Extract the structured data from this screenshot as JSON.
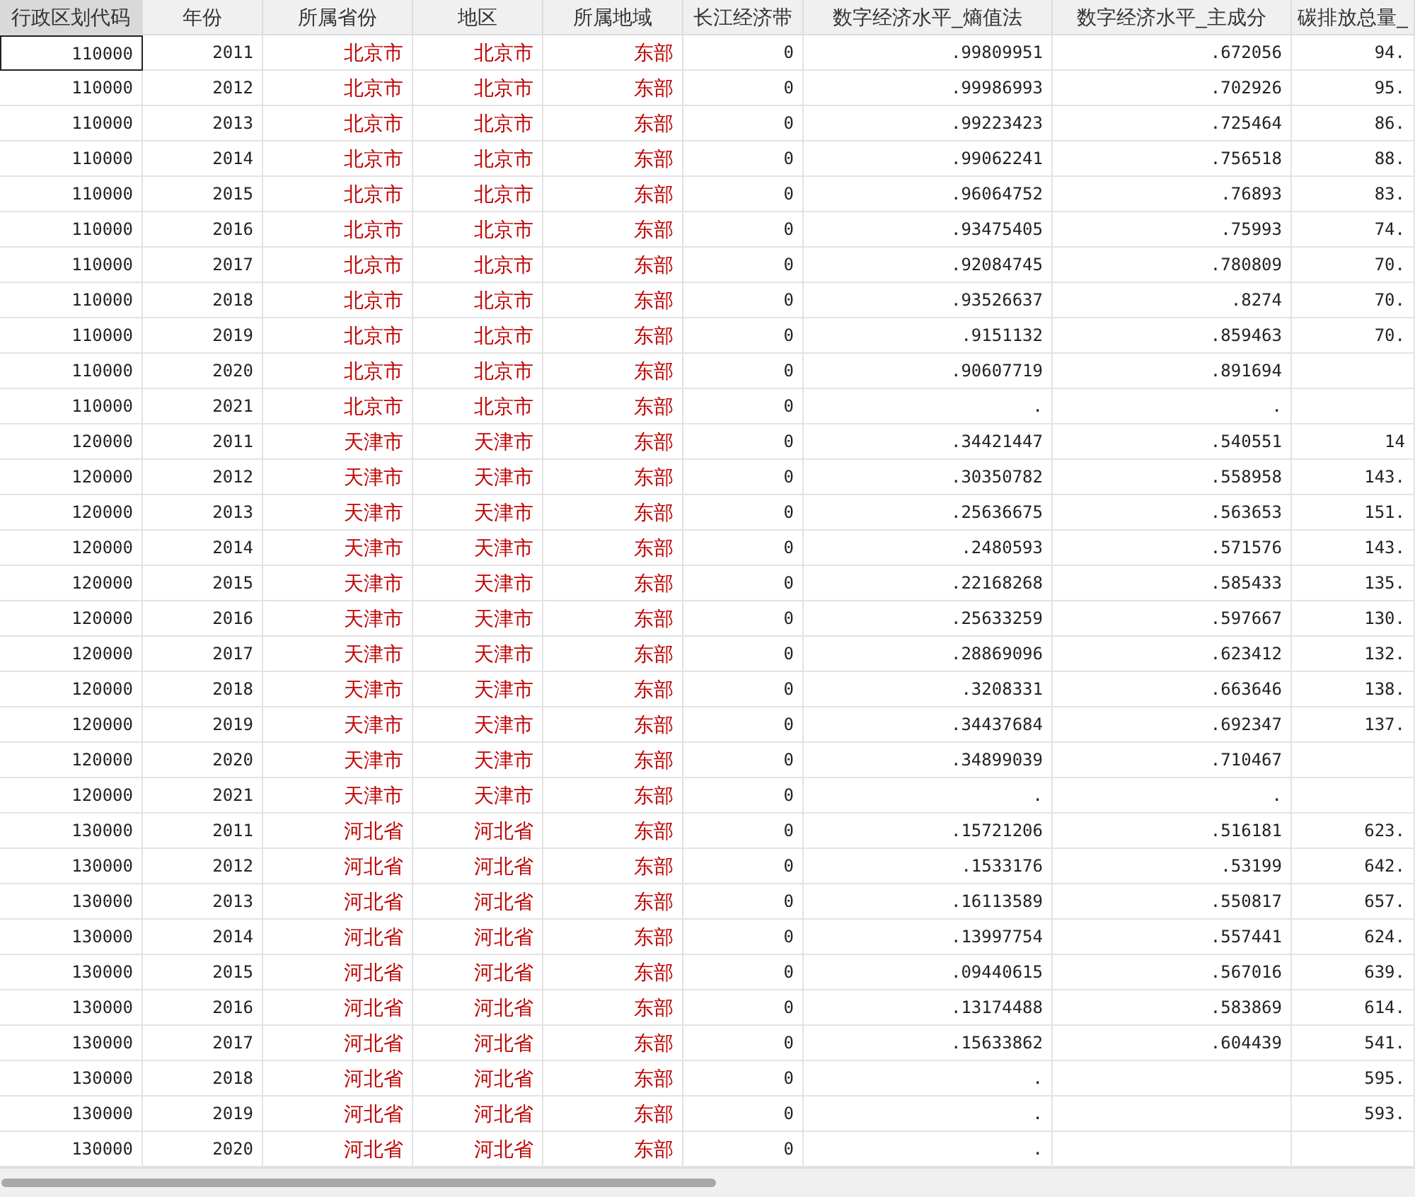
{
  "table": {
    "columns": [
      {
        "label": "行政区划代码",
        "kind": "numeric",
        "selected": true
      },
      {
        "label": "年份",
        "kind": "numeric",
        "selected": false
      },
      {
        "label": "所属省份",
        "kind": "string",
        "selected": false
      },
      {
        "label": "地区",
        "kind": "string",
        "selected": false
      },
      {
        "label": "所属地域",
        "kind": "string",
        "selected": false
      },
      {
        "label": "长江经济带",
        "kind": "numeric",
        "selected": false
      },
      {
        "label": "数字经济水平_熵值法",
        "kind": "numeric",
        "selected": false
      },
      {
        "label": "数字经济水平_主成分",
        "kind": "numeric",
        "selected": false
      },
      {
        "label": "碳排放总量_",
        "kind": "numeric",
        "selected": false
      }
    ],
    "rows": [
      {
        "focused": true,
        "cells": [
          "110000",
          "2011",
          "北京市",
          "北京市",
          "东部",
          "0",
          ".99809951",
          ".672056",
          "94."
        ]
      },
      {
        "focused": false,
        "cells": [
          "110000",
          "2012",
          "北京市",
          "北京市",
          "东部",
          "0",
          ".99986993",
          ".702926",
          "95."
        ]
      },
      {
        "focused": false,
        "cells": [
          "110000",
          "2013",
          "北京市",
          "北京市",
          "东部",
          "0",
          ".99223423",
          ".725464",
          "86."
        ]
      },
      {
        "focused": false,
        "cells": [
          "110000",
          "2014",
          "北京市",
          "北京市",
          "东部",
          "0",
          ".99062241",
          ".756518",
          "88."
        ]
      },
      {
        "focused": false,
        "cells": [
          "110000",
          "2015",
          "北京市",
          "北京市",
          "东部",
          "0",
          ".96064752",
          ".76893",
          "83."
        ]
      },
      {
        "focused": false,
        "cells": [
          "110000",
          "2016",
          "北京市",
          "北京市",
          "东部",
          "0",
          ".93475405",
          ".75993",
          "74."
        ]
      },
      {
        "focused": false,
        "cells": [
          "110000",
          "2017",
          "北京市",
          "北京市",
          "东部",
          "0",
          ".92084745",
          ".780809",
          "70."
        ]
      },
      {
        "focused": false,
        "cells": [
          "110000",
          "2018",
          "北京市",
          "北京市",
          "东部",
          "0",
          ".93526637",
          ".8274",
          "70."
        ]
      },
      {
        "focused": false,
        "cells": [
          "110000",
          "2019",
          "北京市",
          "北京市",
          "东部",
          "0",
          ".9151132",
          ".859463",
          "70."
        ]
      },
      {
        "focused": false,
        "cells": [
          "110000",
          "2020",
          "北京市",
          "北京市",
          "东部",
          "0",
          ".90607719",
          ".891694",
          ""
        ]
      },
      {
        "focused": false,
        "cells": [
          "110000",
          "2021",
          "北京市",
          "北京市",
          "东部",
          "0",
          ".",
          ".",
          ""
        ]
      },
      {
        "focused": false,
        "cells": [
          "120000",
          "2011",
          "天津市",
          "天津市",
          "东部",
          "0",
          ".34421447",
          ".540551",
          "14"
        ]
      },
      {
        "focused": false,
        "cells": [
          "120000",
          "2012",
          "天津市",
          "天津市",
          "东部",
          "0",
          ".30350782",
          ".558958",
          "143."
        ]
      },
      {
        "focused": false,
        "cells": [
          "120000",
          "2013",
          "天津市",
          "天津市",
          "东部",
          "0",
          ".25636675",
          ".563653",
          "151."
        ]
      },
      {
        "focused": false,
        "cells": [
          "120000",
          "2014",
          "天津市",
          "天津市",
          "东部",
          "0",
          ".2480593",
          ".571576",
          "143."
        ]
      },
      {
        "focused": false,
        "cells": [
          "120000",
          "2015",
          "天津市",
          "天津市",
          "东部",
          "0",
          ".22168268",
          ".585433",
          "135."
        ]
      },
      {
        "focused": false,
        "cells": [
          "120000",
          "2016",
          "天津市",
          "天津市",
          "东部",
          "0",
          ".25633259",
          ".597667",
          "130."
        ]
      },
      {
        "focused": false,
        "cells": [
          "120000",
          "2017",
          "天津市",
          "天津市",
          "东部",
          "0",
          ".28869096",
          ".623412",
          "132."
        ]
      },
      {
        "focused": false,
        "cells": [
          "120000",
          "2018",
          "天津市",
          "天津市",
          "东部",
          "0",
          ".3208331",
          ".663646",
          "138."
        ]
      },
      {
        "focused": false,
        "cells": [
          "120000",
          "2019",
          "天津市",
          "天津市",
          "东部",
          "0",
          ".34437684",
          ".692347",
          "137."
        ]
      },
      {
        "focused": false,
        "cells": [
          "120000",
          "2020",
          "天津市",
          "天津市",
          "东部",
          "0",
          ".34899039",
          ".710467",
          ""
        ]
      },
      {
        "focused": false,
        "cells": [
          "120000",
          "2021",
          "天津市",
          "天津市",
          "东部",
          "0",
          ".",
          ".",
          ""
        ]
      },
      {
        "focused": false,
        "cells": [
          "130000",
          "2011",
          "河北省",
          "河北省",
          "东部",
          "0",
          ".15721206",
          ".516181",
          "623."
        ]
      },
      {
        "focused": false,
        "cells": [
          "130000",
          "2012",
          "河北省",
          "河北省",
          "东部",
          "0",
          ".1533176",
          ".53199",
          "642."
        ]
      },
      {
        "focused": false,
        "cells": [
          "130000",
          "2013",
          "河北省",
          "河北省",
          "东部",
          "0",
          ".16113589",
          ".550817",
          "657."
        ]
      },
      {
        "focused": false,
        "cells": [
          "130000",
          "2014",
          "河北省",
          "河北省",
          "东部",
          "0",
          ".13997754",
          ".557441",
          "624."
        ]
      },
      {
        "focused": false,
        "cells": [
          "130000",
          "2015",
          "河北省",
          "河北省",
          "东部",
          "0",
          ".09440615",
          ".567016",
          "639."
        ]
      },
      {
        "focused": false,
        "cells": [
          "130000",
          "2016",
          "河北省",
          "河北省",
          "东部",
          "0",
          ".13174488",
          ".583869",
          "614."
        ]
      },
      {
        "focused": false,
        "cells": [
          "130000",
          "2017",
          "河北省",
          "河北省",
          "东部",
          "0",
          ".15633862",
          ".604439",
          "541."
        ]
      },
      {
        "focused": false,
        "cells": [
          "130000",
          "2018",
          "河北省",
          "河北省",
          "东部",
          "0",
          ".",
          "",
          "595."
        ]
      },
      {
        "focused": false,
        "cells": [
          "130000",
          "2019",
          "河北省",
          "河北省",
          "东部",
          "0",
          ".",
          "",
          "593."
        ]
      },
      {
        "focused": false,
        "cells": [
          "130000",
          "2020",
          "河北省",
          "河北省",
          "东部",
          "0",
          ".",
          "",
          ""
        ]
      }
    ]
  }
}
